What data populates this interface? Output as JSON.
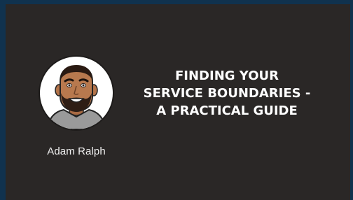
{
  "speaker": {
    "name": "Adam Ralph",
    "avatar_icon": "speaker-avatar-icon"
  },
  "talk": {
    "title_lines": [
      "FINDING YOUR",
      "SERVICE BOUNDARIES -",
      "A PRACTICAL GUIDE"
    ]
  },
  "colors": {
    "frame": "#10324e",
    "card_background": "#2a2726",
    "text": "#ffffff"
  }
}
